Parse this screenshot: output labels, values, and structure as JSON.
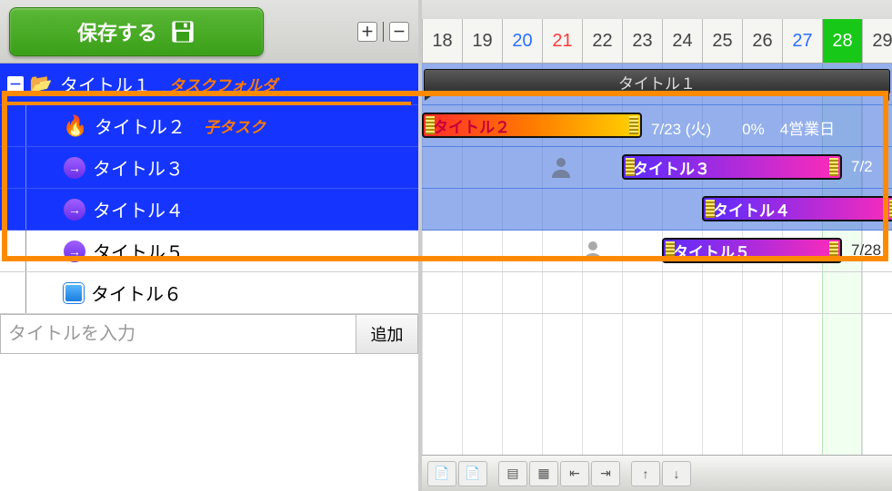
{
  "toolbar": {
    "save_label": "保存する",
    "expand_symbol": "＋",
    "collapse_symbol": "－"
  },
  "tree": {
    "items": [
      {
        "label": "タイトル１",
        "annotation": "タスクフォルダ",
        "level": 0,
        "icon": "folder",
        "selected": true,
        "collapsible": true
      },
      {
        "label": "タイトル２",
        "annotation": "子タスク",
        "level": 1,
        "icon": "fire",
        "selected": true
      },
      {
        "label": "タイトル３",
        "annotation": "",
        "level": 1,
        "icon": "arrow",
        "selected": true
      },
      {
        "label": "タイトル４",
        "annotation": "",
        "level": 1,
        "icon": "arrow",
        "selected": true
      },
      {
        "label": "タイトル５",
        "annotation": "",
        "level": 1,
        "icon": "arrow",
        "selected": false
      },
      {
        "label": "タイトル６",
        "annotation": "",
        "level": 1,
        "icon": "sq",
        "selected": false
      }
    ]
  },
  "add_task": {
    "placeholder": "タイトルを入力",
    "button_label": "追加"
  },
  "dates": [
    {
      "d": "18",
      "cls": ""
    },
    {
      "d": "19",
      "cls": ""
    },
    {
      "d": "20",
      "cls": "sat"
    },
    {
      "d": "21",
      "cls": "sun"
    },
    {
      "d": "22",
      "cls": ""
    },
    {
      "d": "23",
      "cls": ""
    },
    {
      "d": "24",
      "cls": ""
    },
    {
      "d": "25",
      "cls": ""
    },
    {
      "d": "26",
      "cls": ""
    },
    {
      "d": "27",
      "cls": "sat"
    },
    {
      "d": "28",
      "cls": "today"
    },
    {
      "d": "29",
      "cls": ""
    }
  ],
  "gantt": {
    "group_header": "タイトル１",
    "bars": [
      {
        "row": 1,
        "label": "タイトル２",
        "start": 0,
        "end": 5.5,
        "style": "fire",
        "after_text": "7/23 (火)　　0%　4営業日"
      },
      {
        "row": 2,
        "label": "タイトル３",
        "start": 5,
        "end": 10.5,
        "style": "purple",
        "after_text": "7/2",
        "avatar_at": 3.2
      },
      {
        "row": 3,
        "label": "タイトル４",
        "start": 7,
        "end": 12,
        "style": "purple",
        "after_text": ""
      },
      {
        "row": 4,
        "label": "タイトル５",
        "start": 6,
        "end": 10.5,
        "style": "purple",
        "after_text": "7/28",
        "avatar_at": 4
      }
    ]
  },
  "colors": {
    "select_bg": "#1535ff",
    "orange": "#ff8a00",
    "today": "#18c818"
  }
}
